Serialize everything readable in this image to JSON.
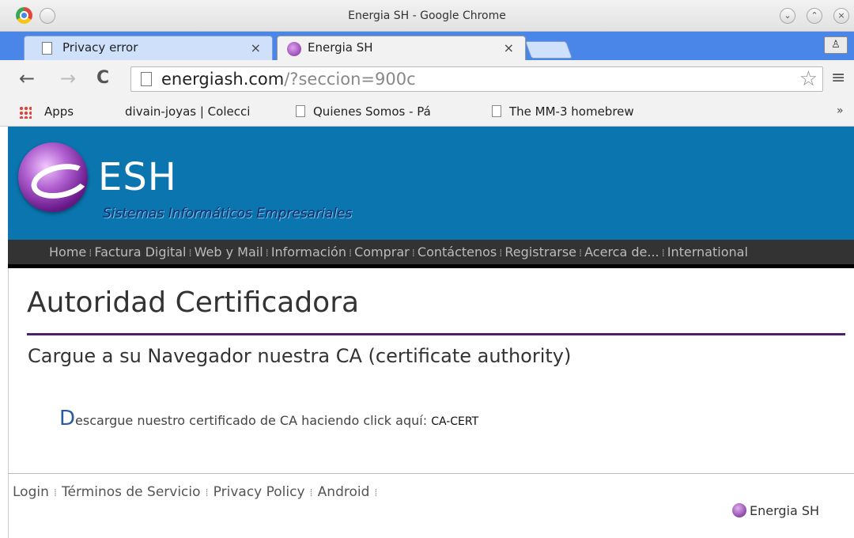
{
  "window": {
    "title": "Energia SH - Google Chrome"
  },
  "tabs": [
    {
      "label": "Privacy error",
      "close": "×"
    },
    {
      "label": "Energia SH",
      "close": "×"
    }
  ],
  "toolbar": {
    "back": "←",
    "forward": "→",
    "reload": "C",
    "url_host": "energiash.com",
    "url_path": "/?seccion=900c",
    "star": "☆",
    "menu": "≡"
  },
  "bookmarks": {
    "apps": "Apps",
    "items": [
      "divain-joyas | Colecci",
      "Quienes Somos - Pá",
      "The MM-3 homebrew"
    ],
    "more": "»"
  },
  "site": {
    "logo_text": "ESH",
    "tagline": "Sistemas Informáticos Empresariales",
    "nav": [
      "Home",
      "Factura Digital",
      "Web y Mail",
      "Información",
      "Comprar",
      "Contáctenos",
      "Registrarse",
      "Acerca de...",
      "International"
    ],
    "nav_sep": "⁞"
  },
  "content": {
    "title": "Autoridad Certificadora",
    "subtitle": "Cargue a su Navegador nuestra CA (certificate authority)",
    "dropcap": "D",
    "text": "escargue nuestro certificado de CA haciendo click aquí:",
    "link": "CA-CERT"
  },
  "footer": {
    "links": [
      "Login",
      "Términos de Servicio",
      "Privacy Policy",
      "Android"
    ],
    "sep": "⁞",
    "brand": "Energia SH"
  },
  "colors": {
    "tabstrip": "#4a86e8",
    "header": "#0a75ae",
    "navbar": "#333333",
    "title_rule": "#4e1f6b"
  }
}
